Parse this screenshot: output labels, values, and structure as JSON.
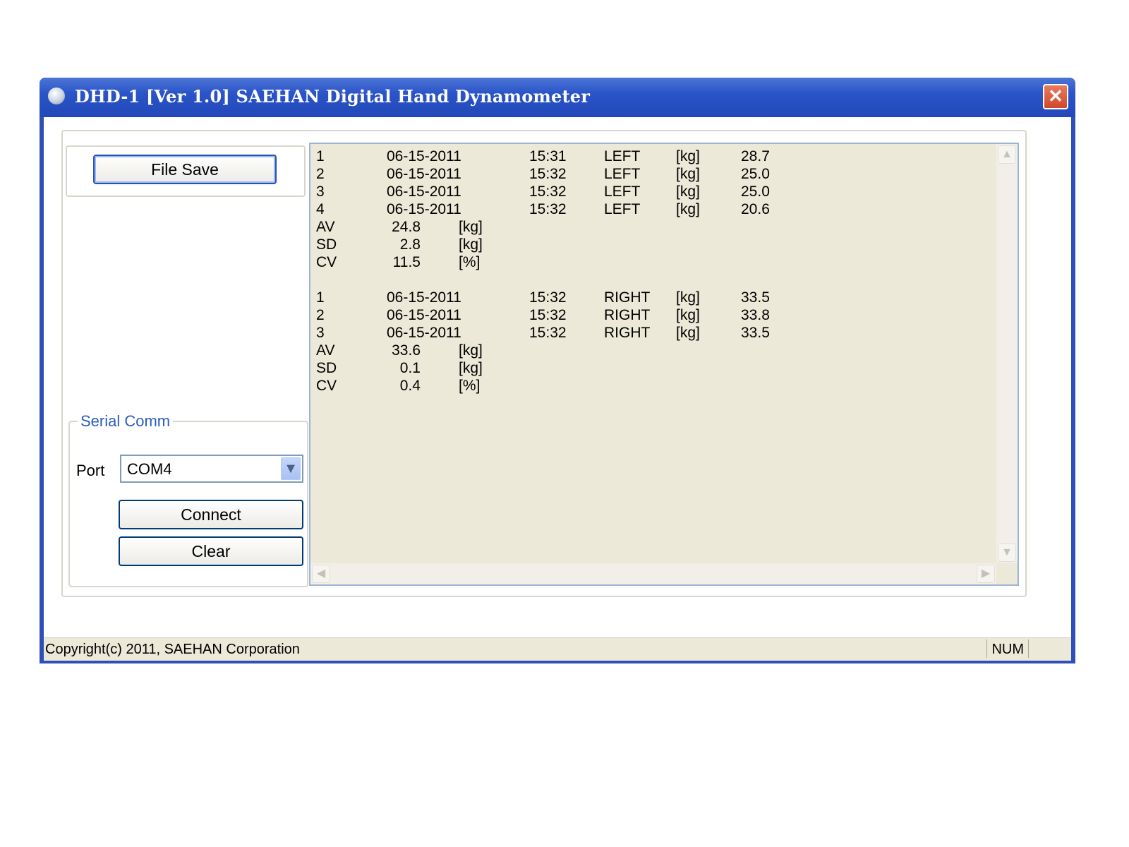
{
  "window": {
    "title": "DHD-1 [Ver 1.0] SAEHAN Digital Hand Dynamometer",
    "close_glyph": "✕",
    "icon": "app-icon"
  },
  "controls": {
    "file_save_label": "File Save",
    "serial_group_label": "Serial Comm",
    "port_label": "Port",
    "port_value": "COM4",
    "connect_label": "Connect",
    "clear_label": "Clear"
  },
  "log": {
    "left_measurements": [
      {
        "n": "1",
        "date": "06-15-2011",
        "time": "15:31",
        "hand": "LEFT",
        "unit": "[kg]",
        "value": "28.7"
      },
      {
        "n": "2",
        "date": "06-15-2011",
        "time": "15:32",
        "hand": "LEFT",
        "unit": "[kg]",
        "value": "25.0"
      },
      {
        "n": "3",
        "date": "06-15-2011",
        "time": "15:32",
        "hand": "LEFT",
        "unit": "[kg]",
        "value": "25.0"
      },
      {
        "n": "4",
        "date": "06-15-2011",
        "time": "15:32",
        "hand": "LEFT",
        "unit": "[kg]",
        "value": "20.6"
      }
    ],
    "left_stats": [
      {
        "label": "AV",
        "value": "24.8",
        "unit": "[kg]"
      },
      {
        "label": "SD",
        "value": "2.8",
        "unit": "[kg]"
      },
      {
        "label": "CV",
        "value": "11.5",
        "unit": "[%]"
      }
    ],
    "right_measurements": [
      {
        "n": "1",
        "date": "06-15-2011",
        "time": "15:32",
        "hand": "RIGHT",
        "unit": "[kg]",
        "value": "33.5"
      },
      {
        "n": "2",
        "date": "06-15-2011",
        "time": "15:32",
        "hand": "RIGHT",
        "unit": "[kg]",
        "value": "33.8"
      },
      {
        "n": "3",
        "date": "06-15-2011",
        "time": "15:32",
        "hand": "RIGHT",
        "unit": "[kg]",
        "value": "33.5"
      }
    ],
    "right_stats": [
      {
        "label": "AV",
        "value": "33.6",
        "unit": "[kg]"
      },
      {
        "label": "SD",
        "value": "0.1",
        "unit": "[kg]"
      },
      {
        "label": "CV",
        "value": "0.4",
        "unit": "[%]"
      }
    ]
  },
  "statusbar": {
    "copyright": "Copyright(c) 2011, SAEHAN Corporation",
    "num_indicator": "NUM"
  }
}
